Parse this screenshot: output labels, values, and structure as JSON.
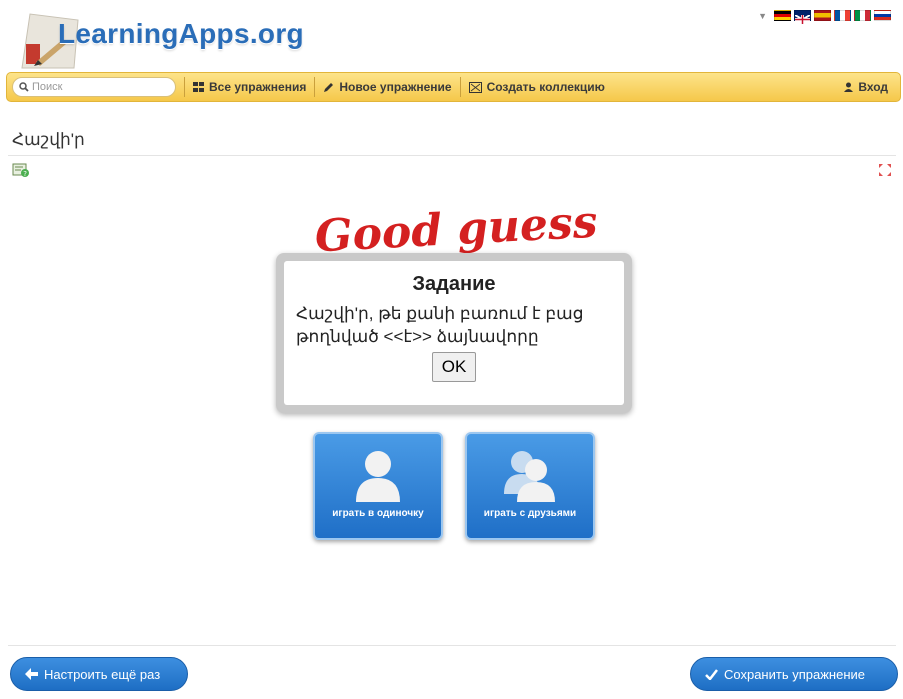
{
  "header": {
    "logo_text": "LearningApps.org",
    "flag_colors": [
      [
        "#000000",
        "#dd0000",
        "#ffce00"
      ],
      [
        "#012169",
        "#ffffff",
        "#c8102e"
      ],
      [
        "#aa151b",
        "#f1bf00",
        "#aa151b"
      ],
      [
        "#0055a4",
        "#ffffff",
        "#ef4135"
      ],
      [
        "#009246",
        "#ffffff",
        "#ce2b37"
      ],
      [
        "#ffffff",
        "#0039a6",
        "#d52b1e"
      ]
    ]
  },
  "toolbar": {
    "search_placeholder": "Поиск",
    "all_exercises": "Все упражнения",
    "new_exercise": "Новое упражнение",
    "create_collection": "Создать коллекцию",
    "login": "Вход"
  },
  "page": {
    "title": "Հաշվի'ր"
  },
  "dialog": {
    "title": "Задание",
    "text": "Հաշվի'ր, թե քանի բառում է բաց թողնված <<է>> ձայնավորը",
    "ok": "OK"
  },
  "game": {
    "banner": "Good guess",
    "play_solo": "играть в одиночку",
    "play_friends": "играть с друзьями"
  },
  "footer": {
    "back_button": "Настроить ещё раз",
    "save_button": "Сохранить упражнение"
  },
  "colors": {
    "accent_blue": "#1f6fc7",
    "toolbar_yellow": "#f5c84a",
    "banner_red": "#d42020"
  }
}
